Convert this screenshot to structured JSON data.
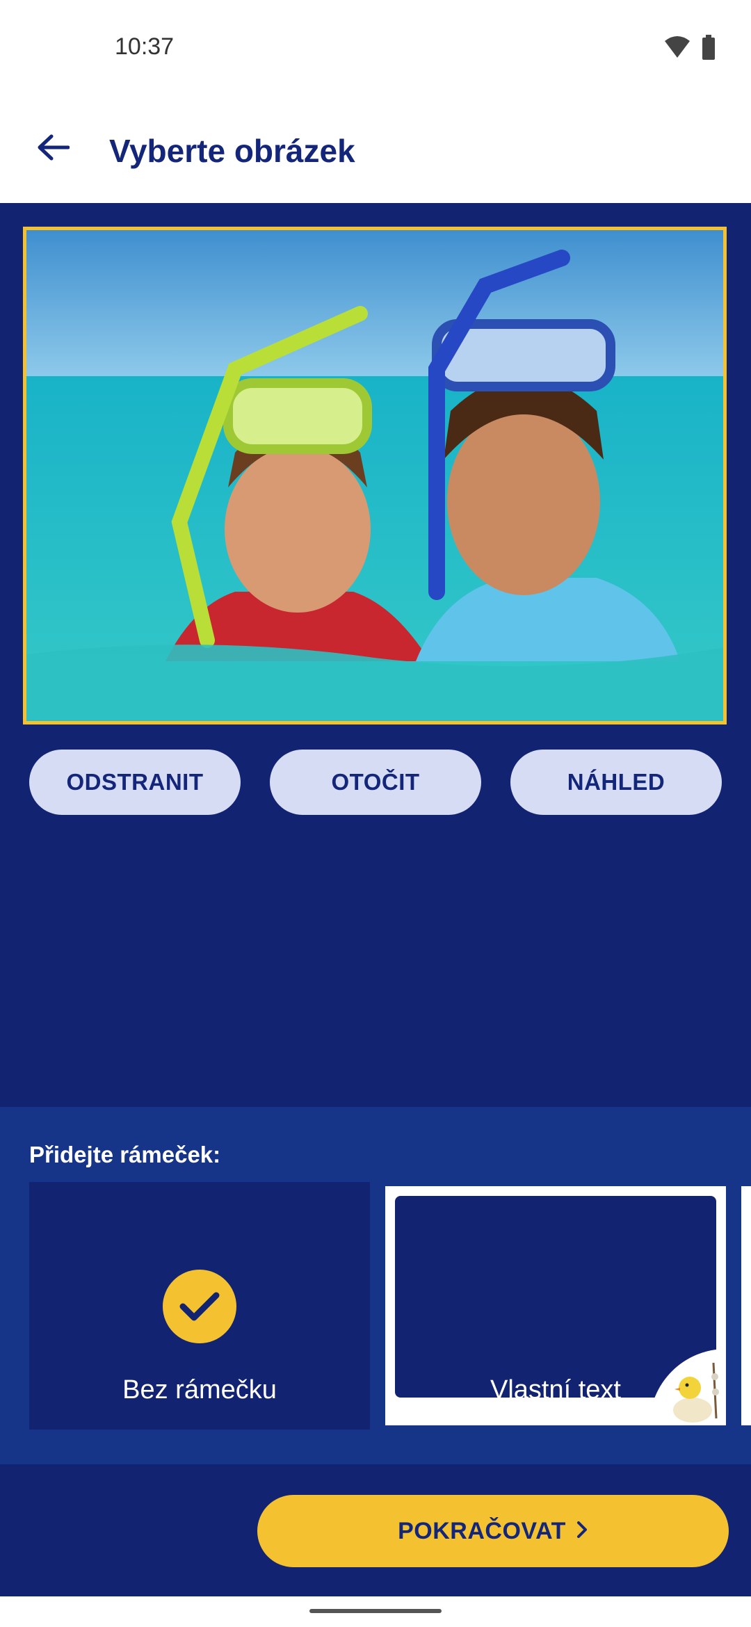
{
  "status_bar": {
    "time": "10:37",
    "icons": [
      "wifi-icon",
      "battery-icon"
    ]
  },
  "app_bar": {
    "back_icon": "arrow-left-icon",
    "title": "Vyberte obrázek"
  },
  "photo": {
    "border_color": "#f4c230"
  },
  "actions": {
    "remove_label": "ODSTRANIT",
    "rotate_label": "OTOČIT",
    "preview_label": "NÁHLED"
  },
  "frames": {
    "title": "Přidejte rámeček:",
    "items": [
      {
        "label": "Bez rámečku",
        "selected": true
      },
      {
        "label": "Vlastní text",
        "selected": false
      }
    ]
  },
  "footer": {
    "continue_label": "POKRAČOVAT",
    "continue_icon": "chevron-right-icon"
  },
  "colors": {
    "primary": "#122372",
    "accent": "#f4c230",
    "pill": "#d6dcf3",
    "title": "#13267a"
  }
}
